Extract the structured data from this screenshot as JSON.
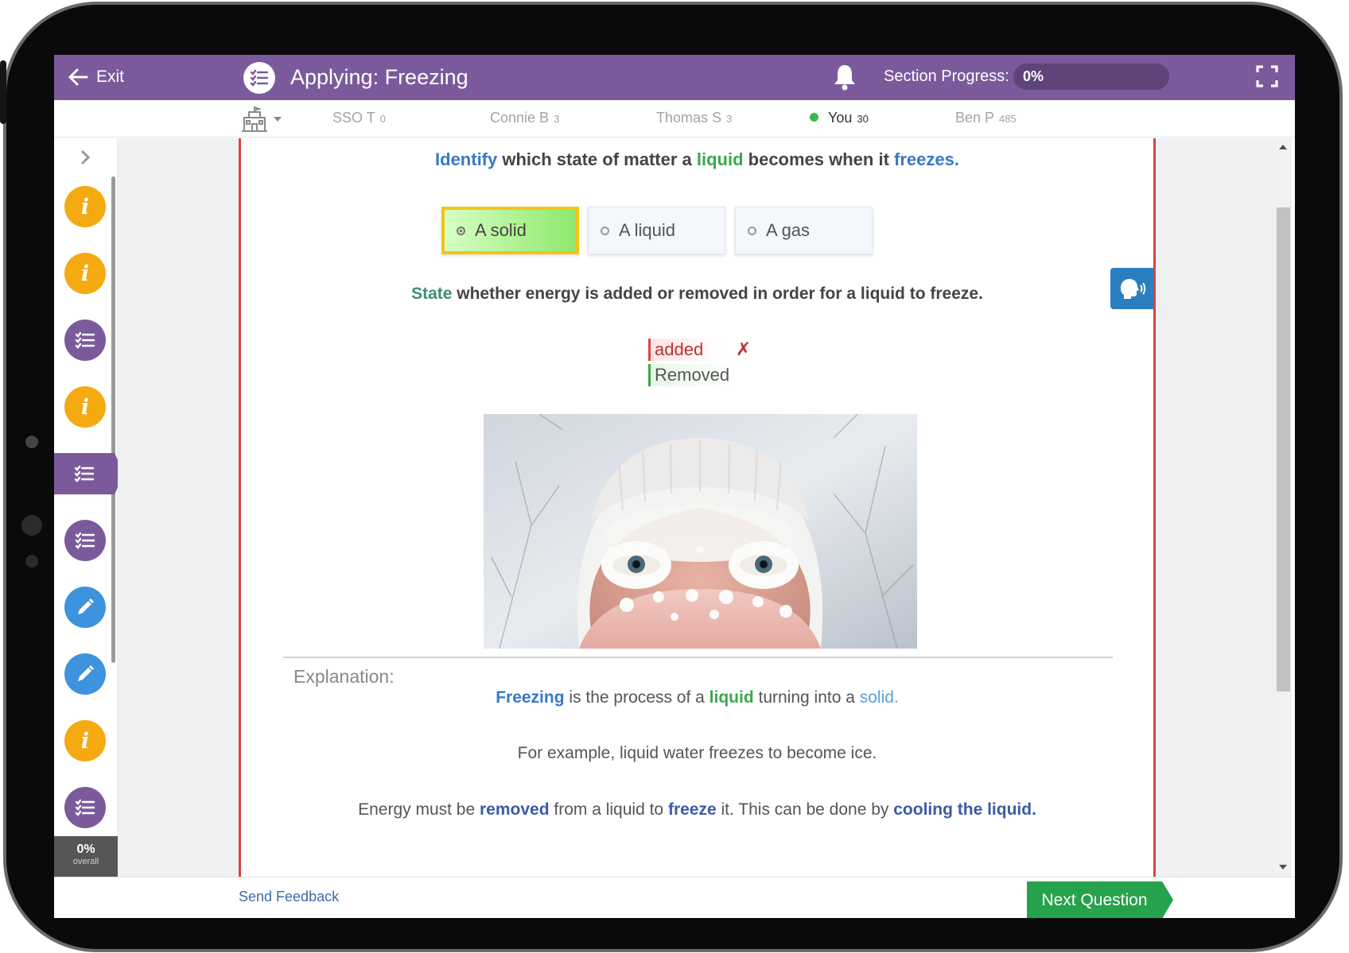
{
  "header": {
    "exit_label": "Exit",
    "lesson_title": "Applying: Freezing",
    "progress_label": "Section Progress:",
    "progress_text": "0%",
    "progress_fraction": 0
  },
  "leaderboard": [
    {
      "name": "SSO T",
      "score": "0",
      "me": false
    },
    {
      "name": "Connie B",
      "score": "3",
      "me": false
    },
    {
      "name": "Thomas S",
      "score": "3",
      "me": false
    },
    {
      "name": "You",
      "score": "30",
      "me": true
    },
    {
      "name": "Ben P",
      "score": "485",
      "me": false
    }
  ],
  "sidebar": {
    "steps": [
      "info",
      "info",
      "list",
      "info",
      "list-active",
      "list",
      "edit",
      "edit",
      "info",
      "list"
    ],
    "overall_pct": "0%",
    "overall_label": "overall"
  },
  "question1": {
    "parts": [
      {
        "text": "Identify",
        "color": "#3878c8"
      },
      {
        "text": " which state of matter a ",
        "color": "#444444"
      },
      {
        "text": "liquid",
        "color": "#3aa84a"
      },
      {
        "text": " becomes when it ",
        "color": "#444444"
      },
      {
        "text": "freezes.",
        "color": "#3878c8"
      }
    ],
    "options": [
      {
        "label": "A solid",
        "selected": true
      },
      {
        "label": "A liquid",
        "selected": false
      },
      {
        "label": "A gas",
        "selected": false
      }
    ]
  },
  "question2": {
    "parts": [
      {
        "text": "State",
        "color": "#3f8d76"
      },
      {
        "text": " whether energy is added or removed in order for a liquid to freeze.",
        "color": "#444444"
      }
    ],
    "wrong_answer": "added",
    "wrong_mark": "✗",
    "correct_answer": "Removed"
  },
  "explanation": {
    "title": "Explanation:",
    "line1": [
      {
        "text": "Freezing",
        "color": "#3878c8",
        "bold": true
      },
      {
        "text": " is the process of a ",
        "color": "#555555",
        "bold": false
      },
      {
        "text": "liquid",
        "color": "#3aa84a",
        "bold": true
      },
      {
        "text": " turning into a ",
        "color": "#555555",
        "bold": false
      },
      {
        "text": "solid.",
        "color": "#5a9fe0",
        "bold": false
      }
    ],
    "line2": "For example, liquid water freezes to become ice.",
    "line3": [
      {
        "text": "Energy must be ",
        "color": "#555555",
        "bold": false
      },
      {
        "text": "removed",
        "color": "#3b5ba5",
        "bold": true
      },
      {
        "text": " from a liquid to ",
        "color": "#555555",
        "bold": false
      },
      {
        "text": "freeze",
        "color": "#3b5ba5",
        "bold": true
      },
      {
        "text": " it. This can be done by ",
        "color": "#555555",
        "bold": false
      },
      {
        "text": "cooling the liquid.",
        "color": "#3b5ba5",
        "bold": true
      }
    ]
  },
  "footer": {
    "feedback_label": "Send Feedback",
    "next_label": "Next Question"
  },
  "colors": {
    "brand_purple": "#7b5a9c",
    "accent_green": "#27a24c",
    "error_red": "#d9443f",
    "info_orange": "#f5aa12",
    "edit_blue": "#3d93dd"
  }
}
